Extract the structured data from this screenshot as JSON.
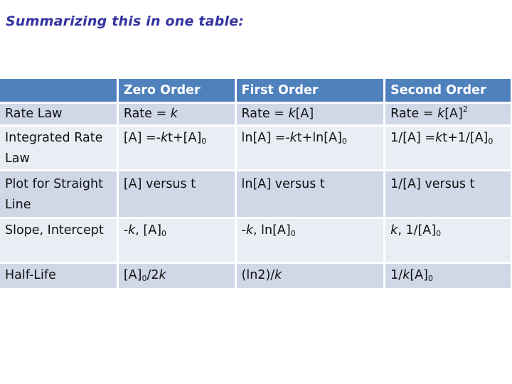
{
  "title": "Summarizing this in one table:",
  "colors": {
    "title": "#3333a0",
    "header_bg": "#4f81bd",
    "row_odd_bg": "#d0d8e8",
    "row_even_bg": "#e9edf4"
  },
  "table": {
    "headers": [
      "",
      "Zero Order",
      "First Order",
      "Second Order"
    ],
    "rows": [
      {
        "label": "Rate Law",
        "cells": [
          [
            {
              "t": "Rate = "
            },
            {
              "t": "k",
              "i": true
            }
          ],
          [
            {
              "t": "Rate = "
            },
            {
              "t": "k",
              "i": true
            },
            {
              "t": "[A]"
            }
          ],
          [
            {
              "t": "Rate = "
            },
            {
              "t": "k",
              "i": true
            },
            {
              "t": "[A]"
            },
            {
              "t": "2",
              "sup": true
            }
          ]
        ]
      },
      {
        "label": "Integrated Rate Law",
        "cells": [
          [
            {
              "t": "[A] =-"
            },
            {
              "t": "k",
              "i": true
            },
            {
              "t": "t+[A]"
            },
            {
              "t": "0",
              "sub": true
            }
          ],
          [
            {
              "t": "ln[A] =-"
            },
            {
              "t": "k",
              "i": true
            },
            {
              "t": "t+ln[A]"
            },
            {
              "t": "0",
              "sub": true
            }
          ],
          [
            {
              "t": "1/[A] ="
            },
            {
              "t": "k",
              "i": true
            },
            {
              "t": "t+1/[A]"
            },
            {
              "t": "0",
              "sub": true
            }
          ]
        ]
      },
      {
        "label": "Plot for Straight Line",
        "cells": [
          [
            {
              "t": "[A] versus t"
            }
          ],
          [
            {
              "t": "ln[A] versus t"
            }
          ],
          [
            {
              "t": "1/[A] versus t"
            }
          ]
        ]
      },
      {
        "label": "Slope, Intercept",
        "cells": [
          [
            {
              "t": "-"
            },
            {
              "t": "k",
              "i": true
            },
            {
              "t": ", [A]"
            },
            {
              "t": "0",
              "sub": true
            }
          ],
          [
            {
              "t": "-"
            },
            {
              "t": "k",
              "i": true
            },
            {
              "t": ", ln[A]"
            },
            {
              "t": "0",
              "sub": true
            }
          ],
          [
            {
              "t": "k",
              "i": true
            },
            {
              "t": ", 1/[A]"
            },
            {
              "t": "0",
              "sub": true
            }
          ]
        ]
      },
      {
        "label": "Half-Life",
        "cells": [
          [
            {
              "t": "[A]"
            },
            {
              "t": "0",
              "sub": true
            },
            {
              "t": "/2"
            },
            {
              "t": "k",
              "i": true
            }
          ],
          [
            {
              "t": "(ln2)/"
            },
            {
              "t": "k",
              "i": true
            }
          ],
          [
            {
              "t": "1/"
            },
            {
              "t": "k",
              "i": true
            },
            {
              "t": "[A]"
            },
            {
              "t": "0",
              "sub": true
            }
          ]
        ]
      }
    ]
  }
}
